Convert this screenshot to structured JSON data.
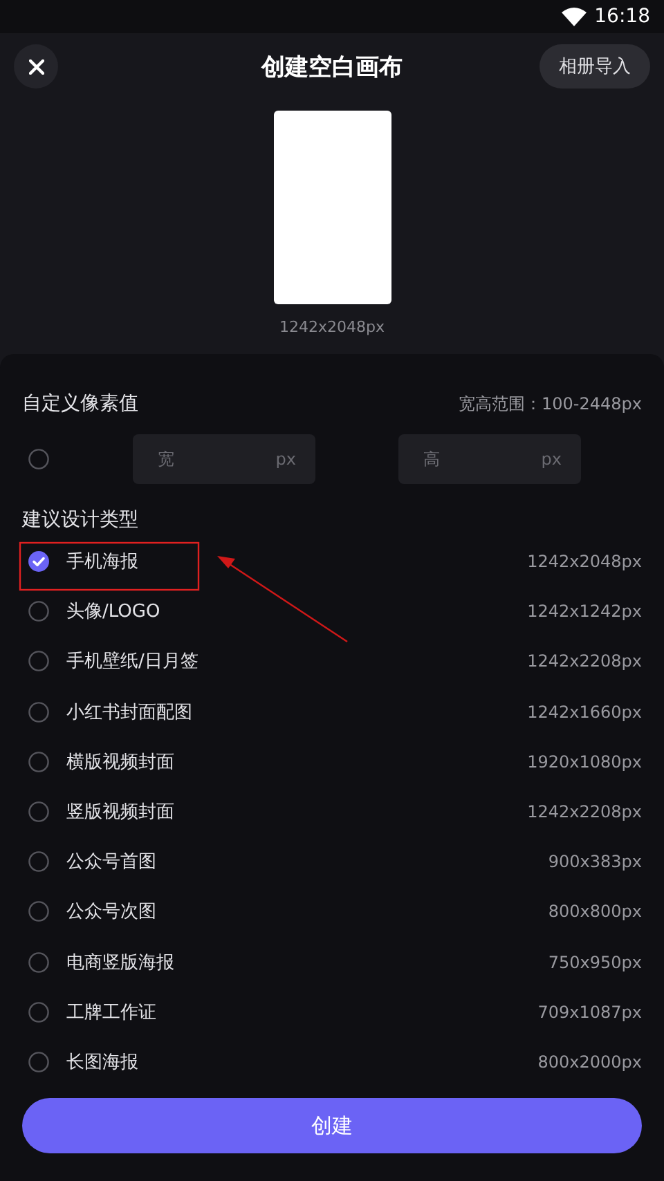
{
  "status_bar": {
    "time": "16:18"
  },
  "header": {
    "title": "创建空白画布",
    "import_button": "相册导入"
  },
  "preview": {
    "size": "1242x2048px"
  },
  "custom": {
    "title": "自定义像素值",
    "range": "宽高范围：100-2448px",
    "selected": false,
    "width_field": {
      "placeholder": "宽",
      "unit": "px"
    },
    "height_field": {
      "placeholder": "高",
      "unit": "px"
    }
  },
  "suggest": {
    "title": "建议设计类型",
    "items": [
      {
        "label": "手机海报",
        "size": "1242x2048px",
        "selected": true
      },
      {
        "label": "头像/LOGO",
        "size": "1242x1242px",
        "selected": false
      },
      {
        "label": "手机壁纸/日月签",
        "size": "1242x2208px",
        "selected": false
      },
      {
        "label": "小红书封面配图",
        "size": "1242x1660px",
        "selected": false
      },
      {
        "label": "横版视频封面",
        "size": "1920x1080px",
        "selected": false
      },
      {
        "label": "竖版视频封面",
        "size": "1242x2208px",
        "selected": false
      },
      {
        "label": "公众号首图",
        "size": "900x383px",
        "selected": false
      },
      {
        "label": "公众号次图",
        "size": "800x800px",
        "selected": false
      },
      {
        "label": "电商竖版海报",
        "size": "750x950px",
        "selected": false
      },
      {
        "label": "工牌工作证",
        "size": "709x1087px",
        "selected": false
      },
      {
        "label": "长图海报",
        "size": "800x2000px",
        "selected": false
      }
    ]
  },
  "create_button": "创建"
}
